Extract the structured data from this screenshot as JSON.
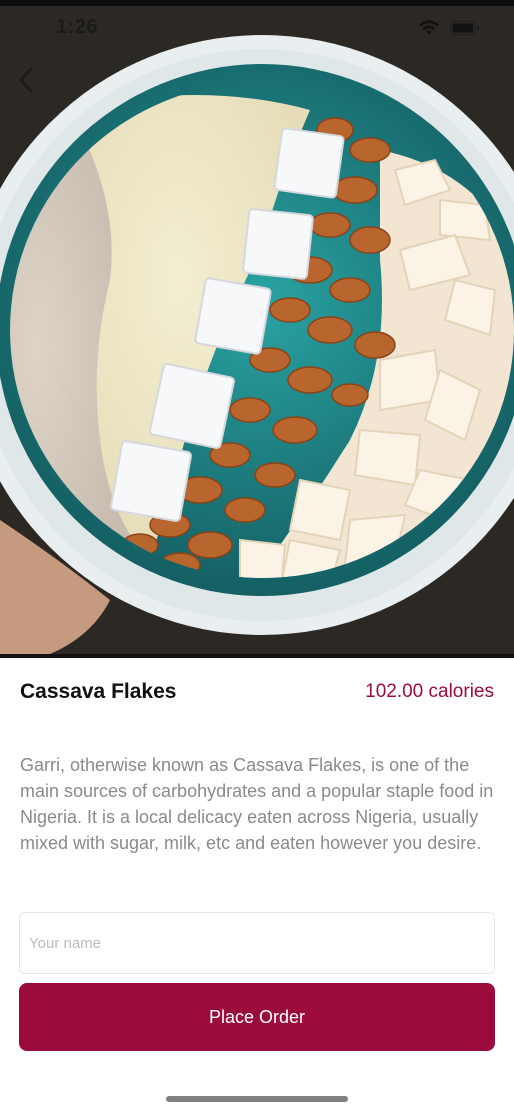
{
  "status_bar": {
    "time": "1:26"
  },
  "hero": {
    "image": "bowl of garri (cassava flakes) with sugar cubes, groundnuts and coconut chips"
  },
  "product": {
    "name": "Cassava Flakes",
    "calories": "102.00 calories",
    "description": "Garri, otherwise known as Cassava Flakes, is one of the main sources of carbohydrates and a popular staple food in Nigeria. It is a local delicacy eaten across Nigeria, usually mixed with sugar, milk, etc and eaten however you desire."
  },
  "form": {
    "name_placeholder": "Your name",
    "name_value": "",
    "order_button": "Place Order"
  },
  "colors": {
    "accent": "#9b0c3a",
    "bowl": "#1f8a8c",
    "description_text": "#8a8a8e"
  },
  "icons": [
    "back-chevron-icon",
    "wifi-icon",
    "battery-icon"
  ]
}
